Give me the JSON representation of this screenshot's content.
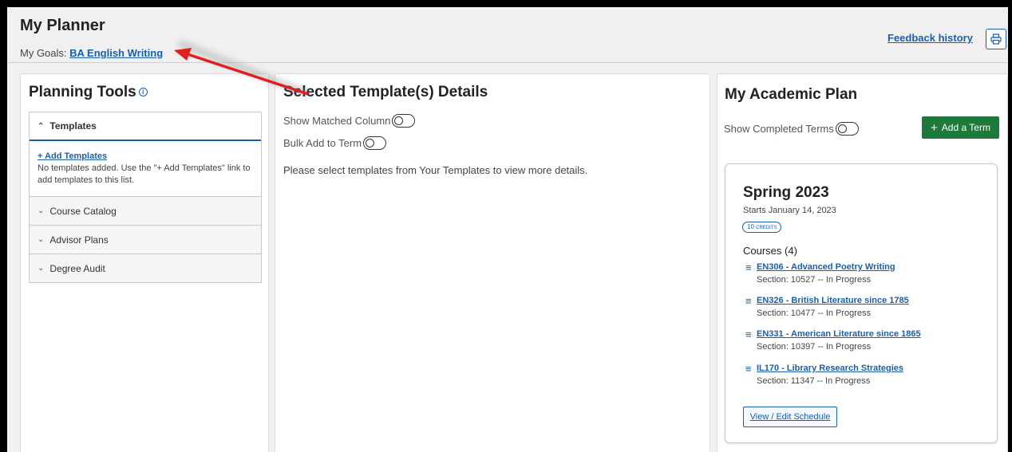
{
  "header": {
    "title": "My Planner",
    "goals_label": "My Goals:",
    "goal_link": "BA English Writing",
    "feedback_link": "Feedback history",
    "print_icon": "printer-icon"
  },
  "planning_tools": {
    "title": "Planning Tools",
    "info_icon": "info-icon",
    "templates": {
      "label": "Templates",
      "add_link": "+ Add Templates",
      "empty_text": "No templates added. Use the \"+ Add Templates\" link to add templates to this list."
    },
    "sections": [
      "Course Catalog",
      "Advisor Plans",
      "Degree Audit"
    ]
  },
  "selected_templates": {
    "title": "Selected Template(s) Details",
    "show_matched": "Show Matched Column",
    "bulk_add": "Bulk Add to Term",
    "message": "Please select templates from Your Templates to view more details."
  },
  "academic_plan": {
    "title": "My Academic Plan",
    "show_completed": "Show Completed Terms",
    "add_term": "Add a Term",
    "term": {
      "name": "Spring 2023",
      "starts": "Starts January 14, 2023",
      "credits": "10 credits",
      "courses_label": "Courses (4)",
      "courses": [
        {
          "title": "EN306 - Advanced Poetry Writing",
          "section": "Section: 10527 -- In Progress"
        },
        {
          "title": "EN326 - British Literature since 1785",
          "section": "Section: 10477 -- In Progress"
        },
        {
          "title": "EN331 - American Literature since 1865",
          "section": "Section: 10397 -- In Progress"
        },
        {
          "title": "IL170 - Library Research Strategies",
          "section": "Section: 11347 -- In Progress"
        }
      ],
      "view_edit": "View / Edit Schedule"
    }
  },
  "colors": {
    "link": "#1b5faa",
    "add_button": "#1e7a3a",
    "arrow": "#e02020"
  }
}
